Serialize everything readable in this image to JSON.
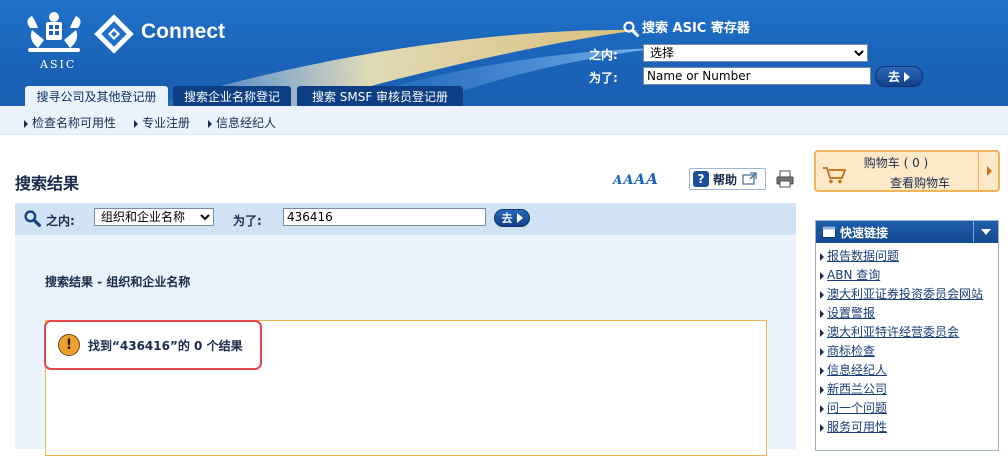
{
  "header": {
    "logo_text": "ASIC",
    "brand": "Connect",
    "search_title": "搜索 ASIC 寄存器",
    "within_label": "之内:",
    "within_value": "选择",
    "for_label": "为了:",
    "for_value": "Name or Number",
    "go_label": "去"
  },
  "tabs": [
    {
      "label": "搜寻公司及其他登记册",
      "active": true
    },
    {
      "label": "搜索企业名称登记",
      "active": false
    },
    {
      "label": "搜索 SMSF 审核员登记册",
      "active": false
    }
  ],
  "subnav": [
    "检查名称可用性",
    "专业注册",
    "信息经纪人"
  ],
  "main": {
    "title": "搜索结果",
    "help_label": "帮助",
    "font_sizes": [
      "A",
      "A",
      "A",
      "A"
    ],
    "search_bar": {
      "within_label": "之内:",
      "within_value": "组织和企业名称",
      "for_label": "为了:",
      "for_value": "436416",
      "go_label": "去"
    },
    "results_heading": "搜索结果 - 组织和企业名称",
    "result_message": "找到“436416”的 0 个结果"
  },
  "cart": {
    "title": "购物车 ( 0 )",
    "link": "查看购物车"
  },
  "quick_links": {
    "title": "快速链接",
    "items": [
      "报告数据问题",
      "ABN 查询",
      "澳大利亚证券投资委员会网站",
      "设置警报",
      "澳大利亚特许经营委员会",
      "商标检查",
      "信息经纪人",
      "新西兰公司",
      "问一个问题",
      "服务可用性"
    ]
  },
  "colors": {
    "header_blue": "#1a63b8",
    "tab_dark": "#0e3f85",
    "panel_light": "#eaf3fb",
    "accent_orange": "#f0b347",
    "highlight_red": "#e3494a"
  }
}
